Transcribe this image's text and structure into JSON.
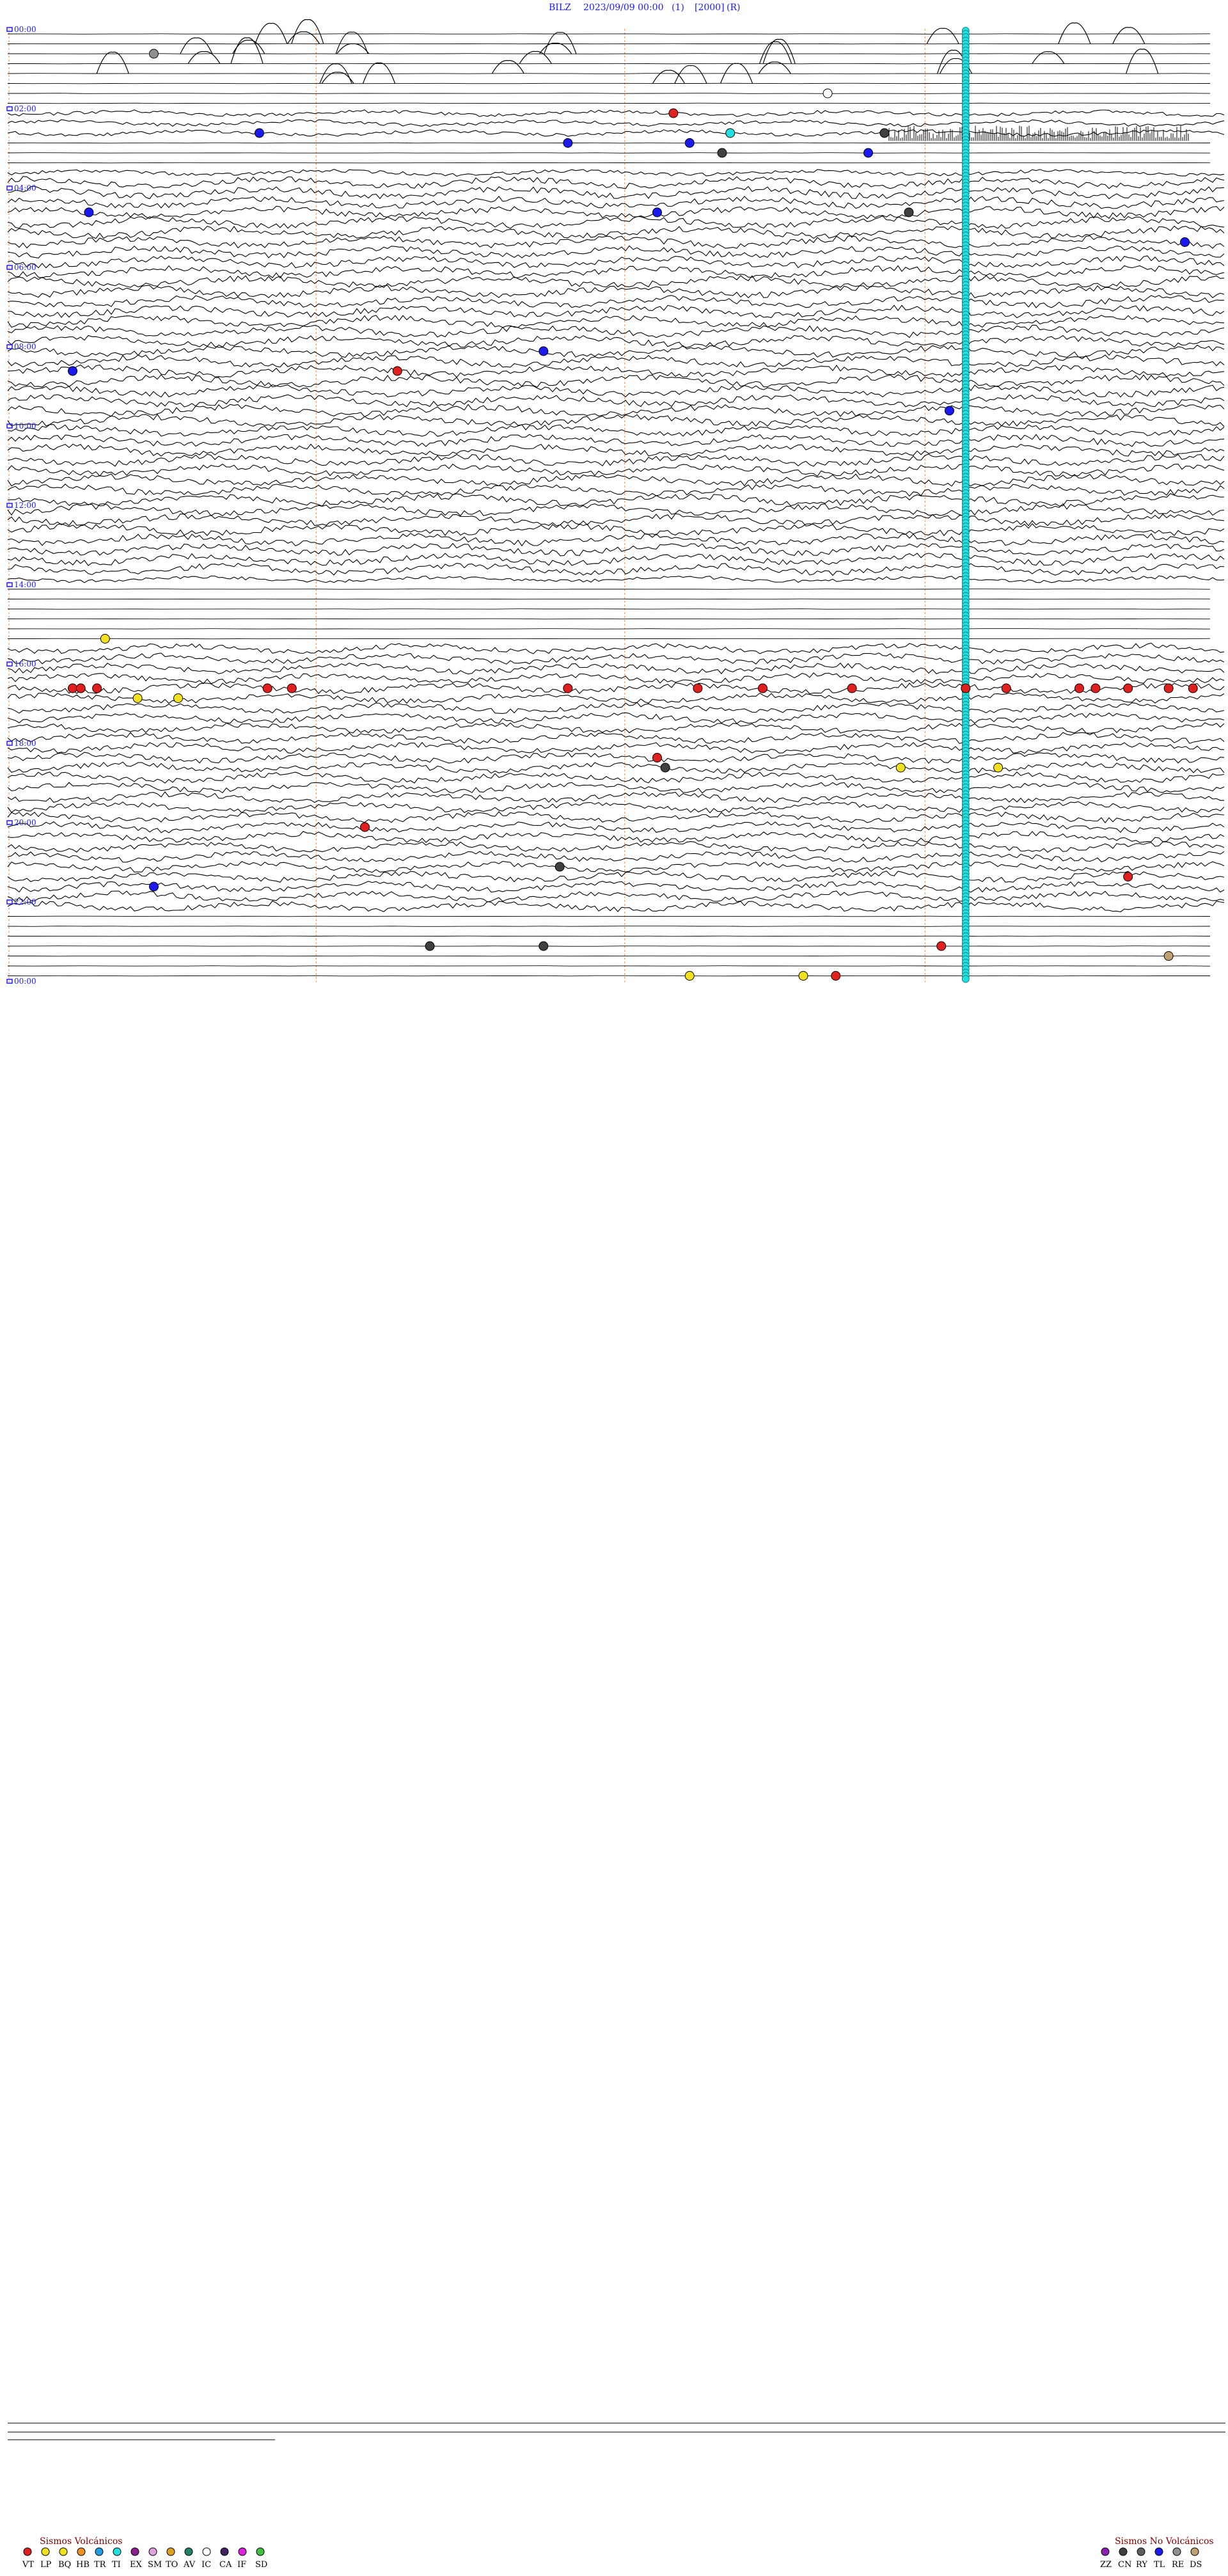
{
  "header": {
    "station": "BILZ",
    "datetime": "2023/09/09 00:00",
    "field1": "(1)",
    "field2": "[2000]",
    "field3": "(R)"
  },
  "hour_labels": [
    "00:00",
    "02:00",
    "04:00",
    "06:00",
    "08:00",
    "10:00",
    "12:00",
    "14:00",
    "16:00",
    "18:00",
    "20:00",
    "22:00",
    "00:00"
  ],
  "legend_volcanic": {
    "title": "Sismos Volcánicos",
    "items": [
      {
        "code": "VT",
        "color": "#e0201e"
      },
      {
        "code": "LP",
        "color": "#f0e020"
      },
      {
        "code": "BQ",
        "color": "#f0e020"
      },
      {
        "code": "HB",
        "color": "#f09020"
      },
      {
        "code": "TR",
        "color": "#20a0e0"
      },
      {
        "code": "TI",
        "color": "#20e0e0"
      },
      {
        "code": "EX",
        "color": "#8a2090"
      },
      {
        "code": "SM",
        "color": "#e0a0e0"
      },
      {
        "code": "TO",
        "color": "#e0a020"
      },
      {
        "code": "AV",
        "color": "#20806a"
      },
      {
        "code": "IC",
        "color": "#ffffff"
      },
      {
        "code": "CA",
        "color": "#402060"
      },
      {
        "code": "IF",
        "color": "#e020e0"
      },
      {
        "code": "SD",
        "color": "#40c040"
      }
    ]
  },
  "legend_nonvolcanic": {
    "title": "Sismos No Volcánicos",
    "items": [
      {
        "code": "ZZ",
        "color": "#8a20b0"
      },
      {
        "code": "CN",
        "color": "#404040"
      },
      {
        "code": "RY",
        "color": "#606060"
      },
      {
        "code": "TL",
        "color": "#1a1aee"
      },
      {
        "code": "RE",
        "color": "#909090"
      },
      {
        "code": "DS",
        "color": "#c0a070"
      }
    ]
  },
  "chart_data": {
    "type": "helicorder",
    "rows": 96,
    "minutes_per_row": 15,
    "row_start_time": "00:00",
    "noisy_row_ranges": [
      [
        8,
        10
      ],
      [
        14,
        55
      ],
      [
        62,
        67
      ],
      [
        68,
        88
      ]
    ],
    "quiet_row_ranges": [
      [
        0,
        7
      ],
      [
        11,
        13
      ],
      [
        56,
        61
      ],
      [
        89,
        95
      ]
    ],
    "events": [
      {
        "row": 2,
        "minute": 1.8,
        "type": "RE"
      },
      {
        "row": 6,
        "minute": 10.1,
        "type": "IC"
      },
      {
        "row": 8,
        "minute": 8.2,
        "type": "VT"
      },
      {
        "row": 10,
        "minute": 3.1,
        "type": "TL"
      },
      {
        "row": 10,
        "minute": 8.9,
        "type": "TI"
      },
      {
        "row": 10,
        "minute": 10.8,
        "type": "CN"
      },
      {
        "row": 11,
        "minute": 6.9,
        "type": "TL"
      },
      {
        "row": 11,
        "minute": 8.4,
        "type": "TL"
      },
      {
        "row": 12,
        "minute": 8.8,
        "type": "CN"
      },
      {
        "row": 12,
        "minute": 10.6,
        "type": "TL"
      },
      {
        "row": 18,
        "minute": 1.0,
        "type": "TL"
      },
      {
        "row": 18,
        "minute": 8.0,
        "type": "TL"
      },
      {
        "row": 18,
        "minute": 11.1,
        "type": "CN"
      },
      {
        "row": 21,
        "minute": 14.5,
        "type": "TL"
      },
      {
        "row": 32,
        "minute": 6.6,
        "type": "TL"
      },
      {
        "row": 34,
        "minute": 0.8,
        "type": "TL"
      },
      {
        "row": 34,
        "minute": 4.8,
        "type": "VT"
      },
      {
        "row": 38,
        "minute": 11.6,
        "type": "TL"
      },
      {
        "row": 61,
        "minute": 1.2,
        "type": "LP"
      },
      {
        "row": 66,
        "minute": 0.8,
        "type": "VT"
      },
      {
        "row": 66,
        "minute": 0.9,
        "type": "VT"
      },
      {
        "row": 66,
        "minute": 1.1,
        "type": "VT"
      },
      {
        "row": 66,
        "minute": 3.2,
        "type": "VT"
      },
      {
        "row": 66,
        "minute": 3.5,
        "type": "VT"
      },
      {
        "row": 66,
        "minute": 6.9,
        "type": "VT"
      },
      {
        "row": 66,
        "minute": 8.5,
        "type": "VT"
      },
      {
        "row": 66,
        "minute": 9.3,
        "type": "VT"
      },
      {
        "row": 66,
        "minute": 10.4,
        "type": "VT"
      },
      {
        "row": 66,
        "minute": 11.8,
        "type": "VT"
      },
      {
        "row": 66,
        "minute": 12.3,
        "type": "VT"
      },
      {
        "row": 66,
        "minute": 13.2,
        "type": "VT"
      },
      {
        "row": 66,
        "minute": 13.4,
        "type": "VT"
      },
      {
        "row": 66,
        "minute": 13.8,
        "type": "VT"
      },
      {
        "row": 66,
        "minute": 14.3,
        "type": "VT"
      },
      {
        "row": 66,
        "minute": 14.6,
        "type": "VT"
      },
      {
        "row": 67,
        "minute": 1.6,
        "type": "LP"
      },
      {
        "row": 67,
        "minute": 2.1,
        "type": "LP"
      },
      {
        "row": 73,
        "minute": 8.0,
        "type": "VT"
      },
      {
        "row": 74,
        "minute": 8.1,
        "type": "CN"
      },
      {
        "row": 74,
        "minute": 11.0,
        "type": "LP"
      },
      {
        "row": 74,
        "minute": 12.2,
        "type": "LP"
      },
      {
        "row": 80,
        "minute": 4.4,
        "type": "VT"
      },
      {
        "row": 84,
        "minute": 6.8,
        "type": "CN"
      },
      {
        "row": 85,
        "minute": 13.8,
        "type": "VT"
      },
      {
        "row": 86,
        "minute": 1.8,
        "type": "TL"
      },
      {
        "row": 92,
        "minute": 11.5,
        "type": "VT"
      },
      {
        "row": 92,
        "minute": 5.2,
        "type": "CN"
      },
      {
        "row": 92,
        "minute": 6.6,
        "type": "CN"
      },
      {
        "row": 93,
        "minute": 14.3,
        "type": "DS"
      },
      {
        "row": 95,
        "minute": 8.4,
        "type": "LP"
      },
      {
        "row": 95,
        "minute": 9.8,
        "type": "LP"
      },
      {
        "row": 95,
        "minute": 10.2,
        "type": "VT"
      }
    ]
  }
}
